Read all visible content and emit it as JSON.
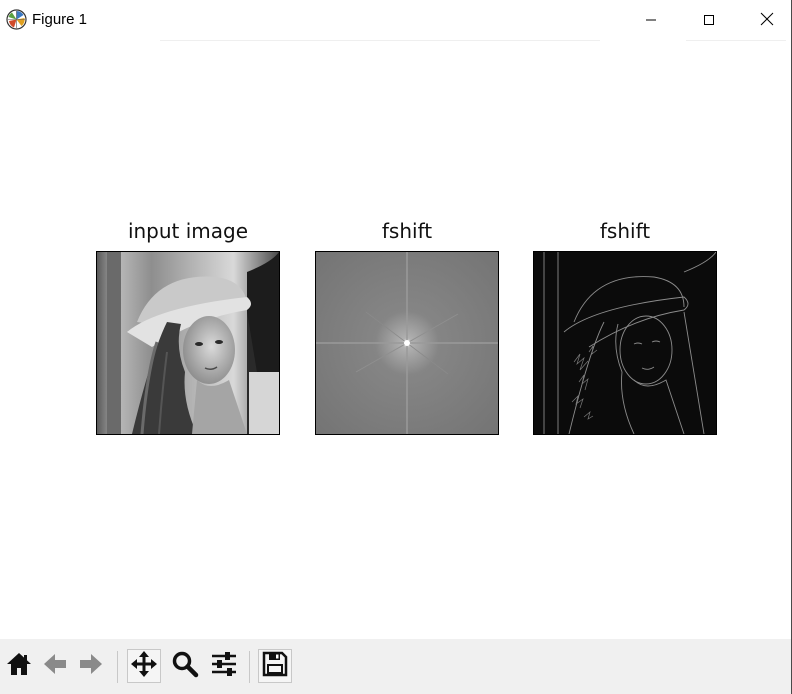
{
  "window": {
    "title": "Figure 1",
    "icons": {
      "app": "matplotlib-logo-icon",
      "minimize": "minimize-icon",
      "maximize": "maximize-icon",
      "close": "close-icon"
    }
  },
  "figure": {
    "subplots": [
      {
        "title": "input image",
        "content": "grayscale portrait photo"
      },
      {
        "title": "fshift",
        "content": "fourier magnitude spectrum"
      },
      {
        "title": "fshift",
        "content": "high-pass filtered edges"
      }
    ]
  },
  "toolbar": {
    "tools": [
      {
        "name": "home",
        "icon": "home-icon"
      },
      {
        "name": "back",
        "icon": "back-arrow-icon"
      },
      {
        "name": "forward",
        "icon": "forward-arrow-icon"
      },
      {
        "name": "pan",
        "icon": "move-icon"
      },
      {
        "name": "zoom",
        "icon": "zoom-icon"
      },
      {
        "name": "configure-subplots",
        "icon": "sliders-icon"
      },
      {
        "name": "save",
        "icon": "save-icon"
      }
    ]
  },
  "colors": {
    "toolbar_bg": "#f0f0f0",
    "window_bg": "#ffffff",
    "spectrum_bg": "#7d7d7d",
    "edges_bg": "#0b0b0b"
  }
}
